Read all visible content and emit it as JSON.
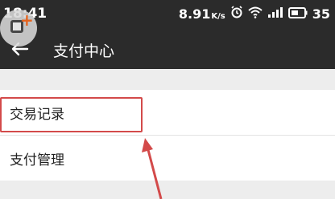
{
  "status_bar": {
    "time": "18:41",
    "speed_value": "8.91",
    "speed_unit": "K/s",
    "battery": "35",
    "icons": [
      "alarm-icon",
      "wifi-icon",
      "signal-icon",
      "battery-icon"
    ]
  },
  "app_bar": {
    "title": "支付中心",
    "back_icon": "back-arrow-icon"
  },
  "menu": {
    "items": [
      {
        "label": "交易记录"
      },
      {
        "label": "支付管理"
      }
    ]
  },
  "annotation": {
    "highlight_color": "#d34a4a"
  }
}
